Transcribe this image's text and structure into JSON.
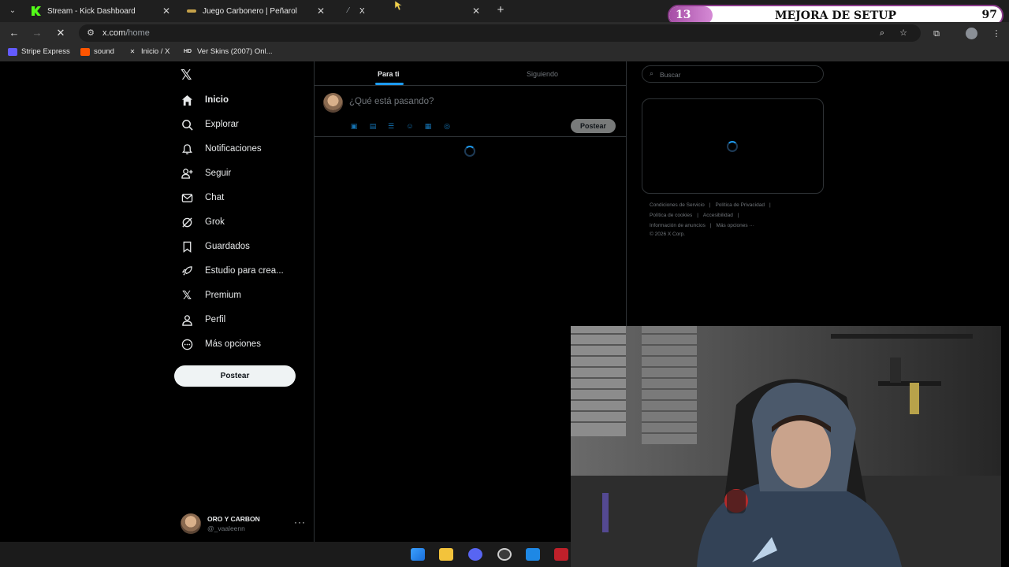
{
  "browser": {
    "tabs": [
      {
        "title": "Stream - Kick Dashboard",
        "icon": "kick-icon"
      },
      {
        "title": "Juego Carbonero | Peñarol",
        "icon": "penarol-icon"
      },
      {
        "title": "X",
        "icon": "x-loading-icon"
      }
    ],
    "url_host": "x.com",
    "url_path": "/home",
    "bookmarks": [
      {
        "label": "Stripe Express",
        "icon": "stripe-icon"
      },
      {
        "label": "sound",
        "icon": "soundcloud-icon"
      },
      {
        "label": "Inicio / X",
        "icon": "x-icon"
      },
      {
        "label": "Ver Skins (2007) Onl...",
        "icon": "hd-icon"
      }
    ],
    "hd_badge": "HD"
  },
  "goal_overlay": {
    "left_value": "13",
    "title": "MEJORA DE SETUP",
    "right_value": "97",
    "progress_fraction": 0.13
  },
  "sidebar": {
    "items": [
      {
        "label": "Inicio",
        "icon": "home-icon"
      },
      {
        "label": "Explorar",
        "icon": "search-icon"
      },
      {
        "label": "Notificaciones",
        "icon": "bell-icon"
      },
      {
        "label": "Seguir",
        "icon": "follow-icon"
      },
      {
        "label": "Chat",
        "icon": "mail-icon"
      },
      {
        "label": "Grok",
        "icon": "grok-icon"
      },
      {
        "label": "Guardados",
        "icon": "bookmark-icon"
      },
      {
        "label": "Estudio para crea...",
        "icon": "rocket-icon"
      },
      {
        "label": "Premium",
        "icon": "x-icon"
      },
      {
        "label": "Perfil",
        "icon": "person-icon"
      },
      {
        "label": "Más opciones",
        "icon": "more-icon"
      }
    ],
    "post_button": "Postear",
    "account": {
      "name": "ORO Y CARBON",
      "handle": "@_vaaleenn"
    }
  },
  "feed": {
    "tabs": [
      "Para ti",
      "Siguiendo"
    ],
    "composer_placeholder": "¿Qué está pasando?",
    "composer_post": "Postear"
  },
  "right": {
    "search_placeholder": "Buscar",
    "footer": [
      [
        "Condiciones de Servicio",
        "Política de Privacidad"
      ],
      [
        "Política de cookies",
        "Accesibilidad"
      ],
      [
        "Información de anuncios",
        "Más opciones ···"
      ],
      [
        "© 2026 X Corp."
      ]
    ]
  },
  "colors": {
    "accent": "#1d9bf0",
    "goal_fill": "#b45cb4",
    "kick_green": "#53fc18"
  }
}
